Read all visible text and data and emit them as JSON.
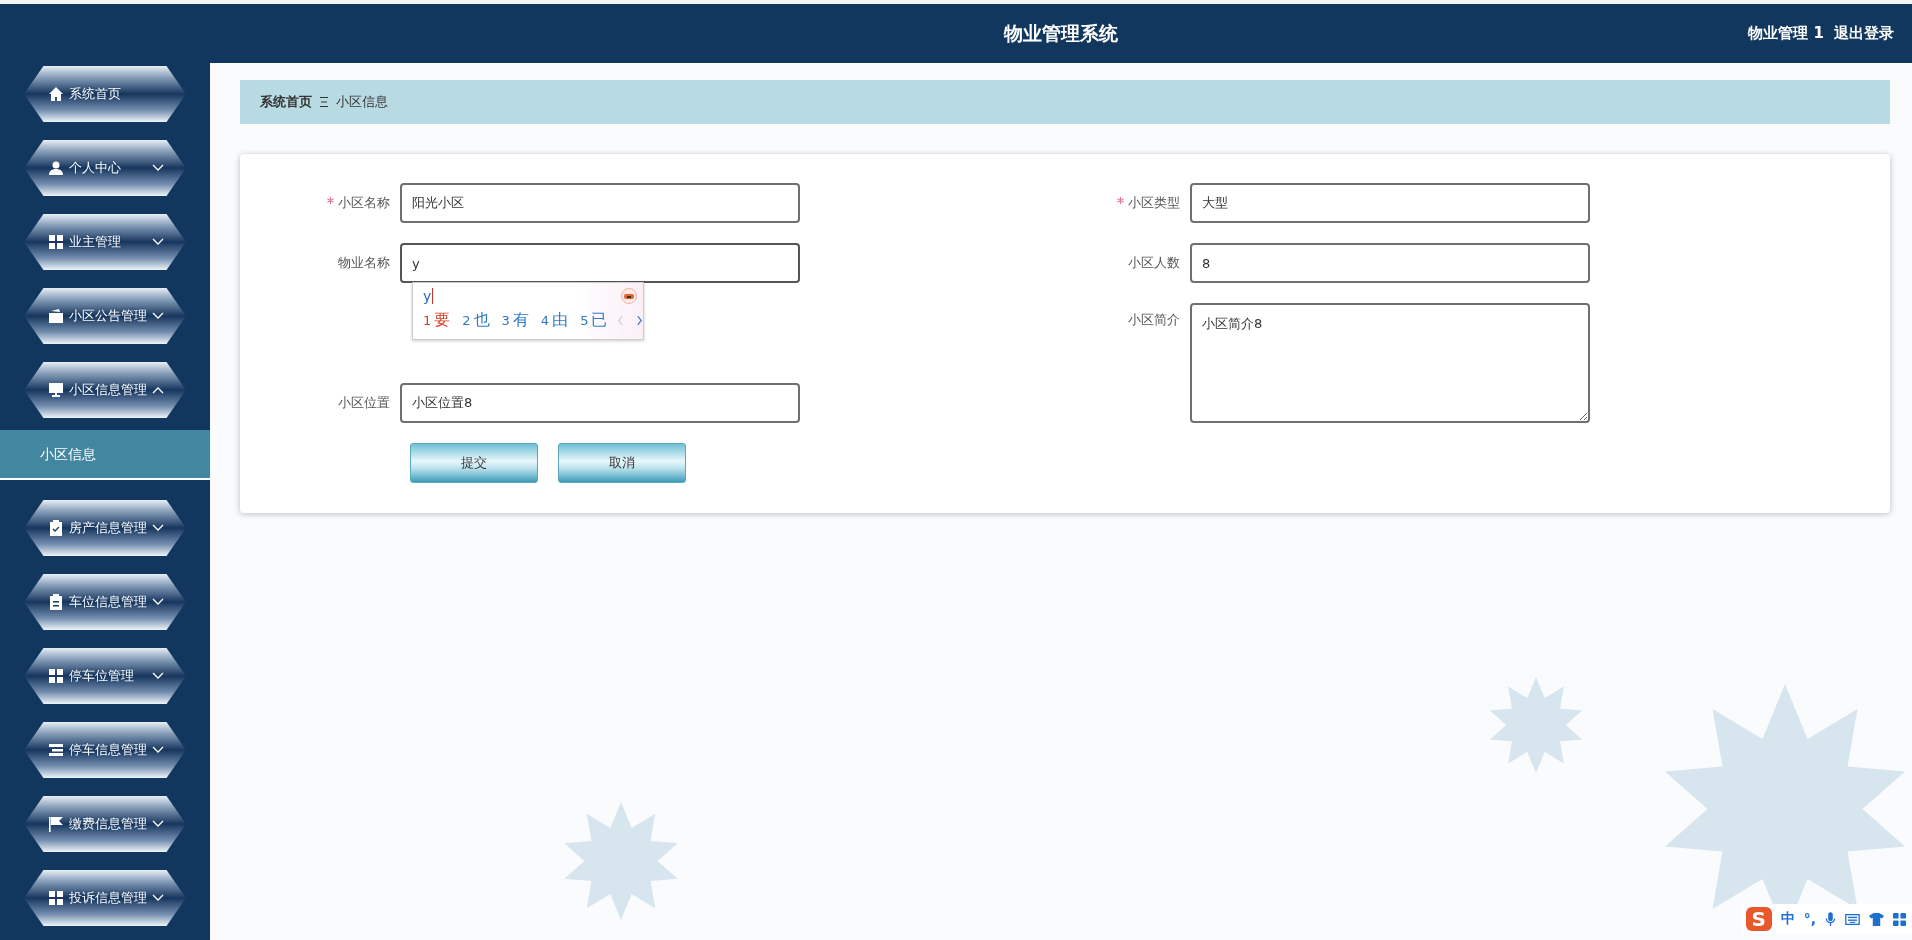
{
  "header": {
    "title": "物业管理系统",
    "user": "物业管理 1",
    "logout": "退出登录"
  },
  "sidebar": {
    "items": [
      {
        "label": "系统首页",
        "expandable": false,
        "expanded": false
      },
      {
        "label": "个人中心",
        "expandable": true,
        "expanded": false
      },
      {
        "label": "业主管理",
        "expandable": true,
        "expanded": false
      },
      {
        "label": "小区公告管理",
        "expandable": true,
        "expanded": false
      },
      {
        "label": "小区信息管理",
        "expandable": true,
        "expanded": true,
        "children": [
          {
            "label": "小区信息",
            "selected": true
          }
        ]
      },
      {
        "label": "房产信息管理",
        "expandable": true,
        "expanded": false
      },
      {
        "label": "车位信息管理",
        "expandable": true,
        "expanded": false
      },
      {
        "label": "停车位管理",
        "expandable": true,
        "expanded": false
      },
      {
        "label": "停车信息管理",
        "expandable": true,
        "expanded": false
      },
      {
        "label": "缴费信息管理",
        "expandable": true,
        "expanded": false
      },
      {
        "label": "投诉信息管理",
        "expandable": true,
        "expanded": false
      }
    ]
  },
  "breadcrumb": [
    "系统首页",
    "小区信息"
  ],
  "form": {
    "fields": [
      {
        "label": "小区名称",
        "required": true,
        "kind": "input",
        "value": "阳光小区",
        "focused": false
      },
      {
        "label": "物业名称",
        "required": false,
        "kind": "input",
        "value": "y",
        "focused": true
      },
      {
        "label": "小区位置",
        "required": false,
        "kind": "input",
        "value": "小区位置8",
        "focused": false
      },
      {
        "label": "小区类型",
        "required": true,
        "kind": "input",
        "value": "大型",
        "focused": false
      },
      {
        "label": "小区人数",
        "required": false,
        "kind": "input",
        "value": "8",
        "focused": false
      },
      {
        "label": "小区简介",
        "required": false,
        "kind": "textarea",
        "value": "小区简介8",
        "focused": false
      }
    ],
    "buttons": [
      "提交",
      "取消"
    ]
  },
  "ime_popup": {
    "composition": "y",
    "candidates": [
      {
        "number": "1",
        "text": "要",
        "selected": true
      },
      {
        "number": "2",
        "text": "也",
        "selected": false
      },
      {
        "number": "3",
        "text": "有",
        "selected": false
      },
      {
        "number": "4",
        "text": "由",
        "selected": false
      },
      {
        "number": "5",
        "text": "已",
        "selected": false
      }
    ]
  },
  "ime_toolbar": {
    "logo": "S",
    "mode": "中",
    "punctuation": "°,"
  }
}
